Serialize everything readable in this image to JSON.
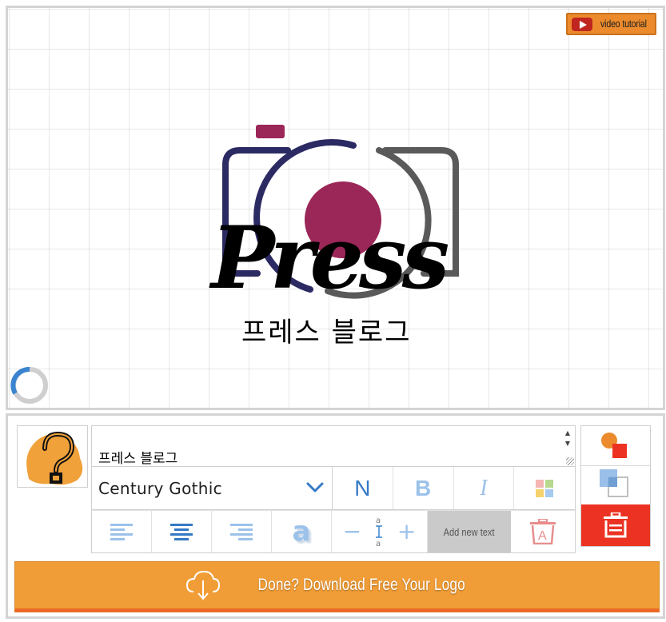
{
  "video_tutorial": {
    "label": "video tutorial",
    "icon": "youtube-play-icon"
  },
  "logo": {
    "title": "Press",
    "subtitle": "프레스 블로그",
    "icon": "camera-icon",
    "colors": {
      "navy": "#2c2a62",
      "plum": "#9b2658",
      "gray": "#5a5a5a",
      "text": "#000000"
    }
  },
  "loader": {
    "icon": "loading-spinner-icon"
  },
  "editor": {
    "character_icon": "question-mark-character-icon",
    "text_value": "프레스 블로그",
    "font": {
      "selected": "Century Gothic"
    },
    "style_buttons": {
      "normal": "N",
      "bold": "B",
      "italic": "I"
    },
    "color_icon": "color-palette-icon",
    "alignment_icons": [
      "align-left-icon",
      "align-center-icon",
      "align-right-icon"
    ],
    "shadow_label": "a",
    "spacing": {
      "minus": "−",
      "plus": "+",
      "icon": "line-height-icon"
    },
    "add_text_label": "Add new text",
    "delete_text_icon": "delete-text-icon",
    "side": {
      "shape_icon": "add-shape-icon",
      "layer_icon": "duplicate-layer-icon",
      "trash_icon": "trash-icon"
    },
    "download": {
      "label": "Done? Download Free Your Logo",
      "icon": "cloud-download-icon"
    }
  },
  "theme": {
    "accent_orange": "#f19d37",
    "danger_red": "#ec3323",
    "toolbar_blue": "#9cc2ea",
    "active_blue": "#3579c5"
  }
}
